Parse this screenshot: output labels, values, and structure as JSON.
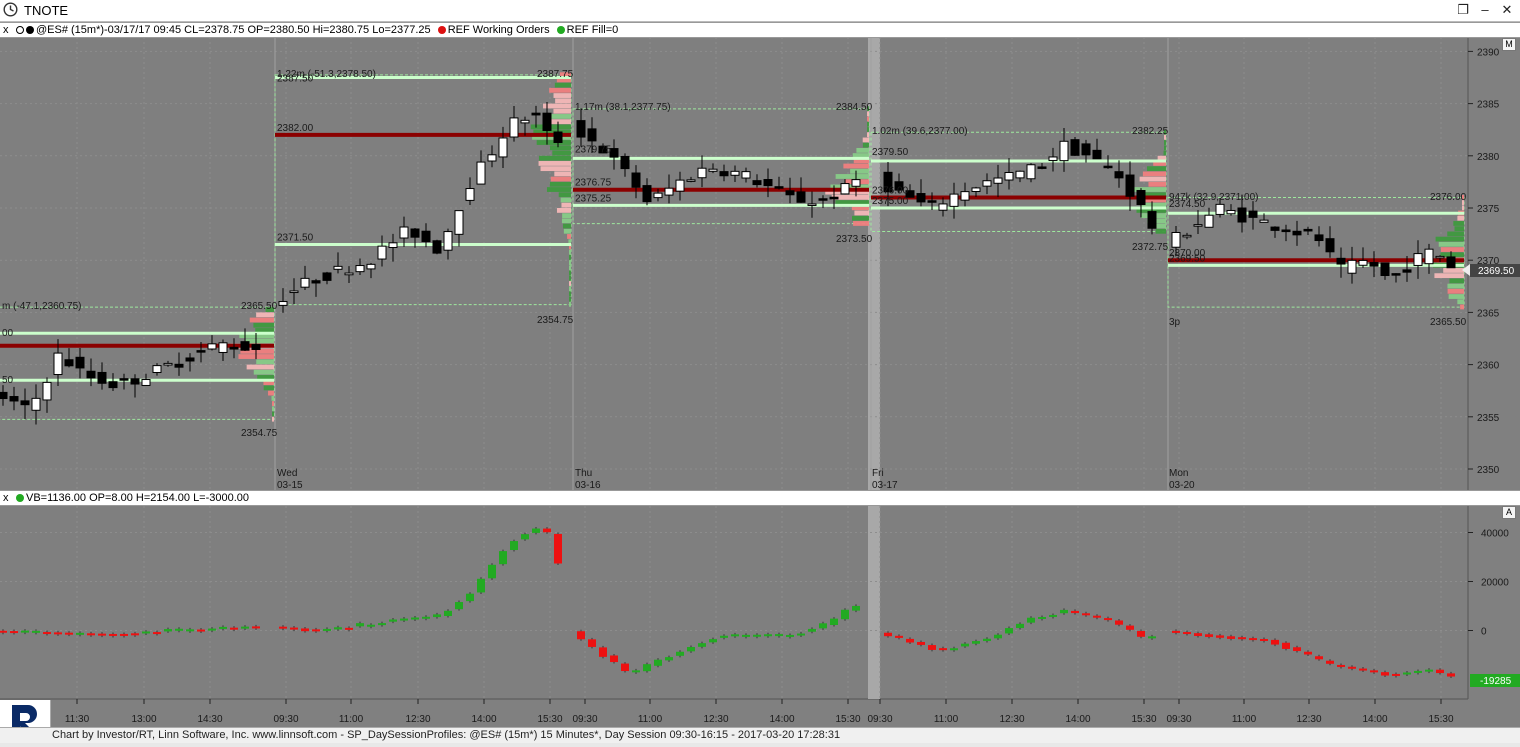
{
  "window": {
    "title": "TNOTE"
  },
  "price_panel": {
    "close_label": "x",
    "header": "@ES# (15m*)-03/17/17 09:45 CL=2378.75 OP=2380.50 Hi=2380.75 Lo=2377.25",
    "ref_working": "REF Working Orders",
    "ref_fill": "REF Fill=0",
    "scale_btn": "M",
    "last_price": "2369.50"
  },
  "volume_panel": {
    "close_label": "x",
    "header": "VB=1136.00 OP=8.00 H=2154.00 L=-3000.00",
    "scale_btn": "A",
    "last_value": "-19285"
  },
  "footer": {
    "text": "Chart by Investor/RT, Linn Software, Inc. www.linnsoft.com - SP_DaySessionProfiles: @ES# (15m*) 15 Minutes*, Day Session 09:30-16:15 - 2017-03-20 17:28:31"
  },
  "colors": {
    "bull": "#ffffff",
    "bear": "#000000",
    "poc": "#8b0000",
    "va": "#ccffcc",
    "vol_up": "#22aa22",
    "vol_down": "#ee1111",
    "bg": "#7f7f7f"
  },
  "chart_data": {
    "type": "candlestick",
    "price_axis": {
      "ticks": [
        2350,
        2355,
        2360,
        2365,
        2370,
        2375,
        2380,
        2385,
        2390
      ],
      "ylim": [
        2347.5,
        2392
      ]
    },
    "volume_axis": {
      "ticks": [
        0,
        20000,
        40000
      ],
      "ylim": [
        -27000,
        46000
      ]
    },
    "days": [
      {
        "day": "Wed",
        "date": "03-15",
        "high": "2387.75",
        "low": "2354.75",
        "profile": "1.22m (-51.3,2378.50)",
        "vah": "2387.50",
        "poc": "2382.00",
        "val": "2371.50"
      },
      {
        "day": "Thu",
        "date": "03-16",
        "high": "2384.50",
        "low": "2365.75",
        "profile": "1.17m (38.1,2377.75)",
        "vah": "2379.75",
        "poc": "2376.75",
        "val": "2375.25",
        "session_low": "2373.50"
      },
      {
        "day": "Fri",
        "date": "03-17",
        "high": "2382.25",
        "low": "2372.75",
        "profile": "1.02m (39.6,2377.00)",
        "vah": "2379.50",
        "poc": "2376.00",
        "val": "2375.00"
      },
      {
        "day": "Mon",
        "date": "03-20",
        "high": "2376.00",
        "low": "2365.50",
        "profile": "947k (32.9,2371.00)",
        "vah": "2374.50",
        "poc": "2370.00",
        "val": "2369.50",
        "marker": "3p"
      }
    ],
    "previous_session": {
      "profile": "m (-47.1,2360.75)",
      "high": "2365.50",
      "vah": "00",
      "val": "50"
    },
    "time_ticks": [
      "11:30",
      "13:00",
      "14:30",
      "09:30",
      "11:00",
      "12:30",
      "14:00",
      "15:30",
      "09:30",
      "11:00",
      "12:30",
      "14:00",
      "15:30",
      "09:30",
      "11:00",
      "12:30",
      "14:00",
      "15:30",
      "09:30",
      "11:00",
      "12:30",
      "14:00",
      "15:30"
    ]
  }
}
